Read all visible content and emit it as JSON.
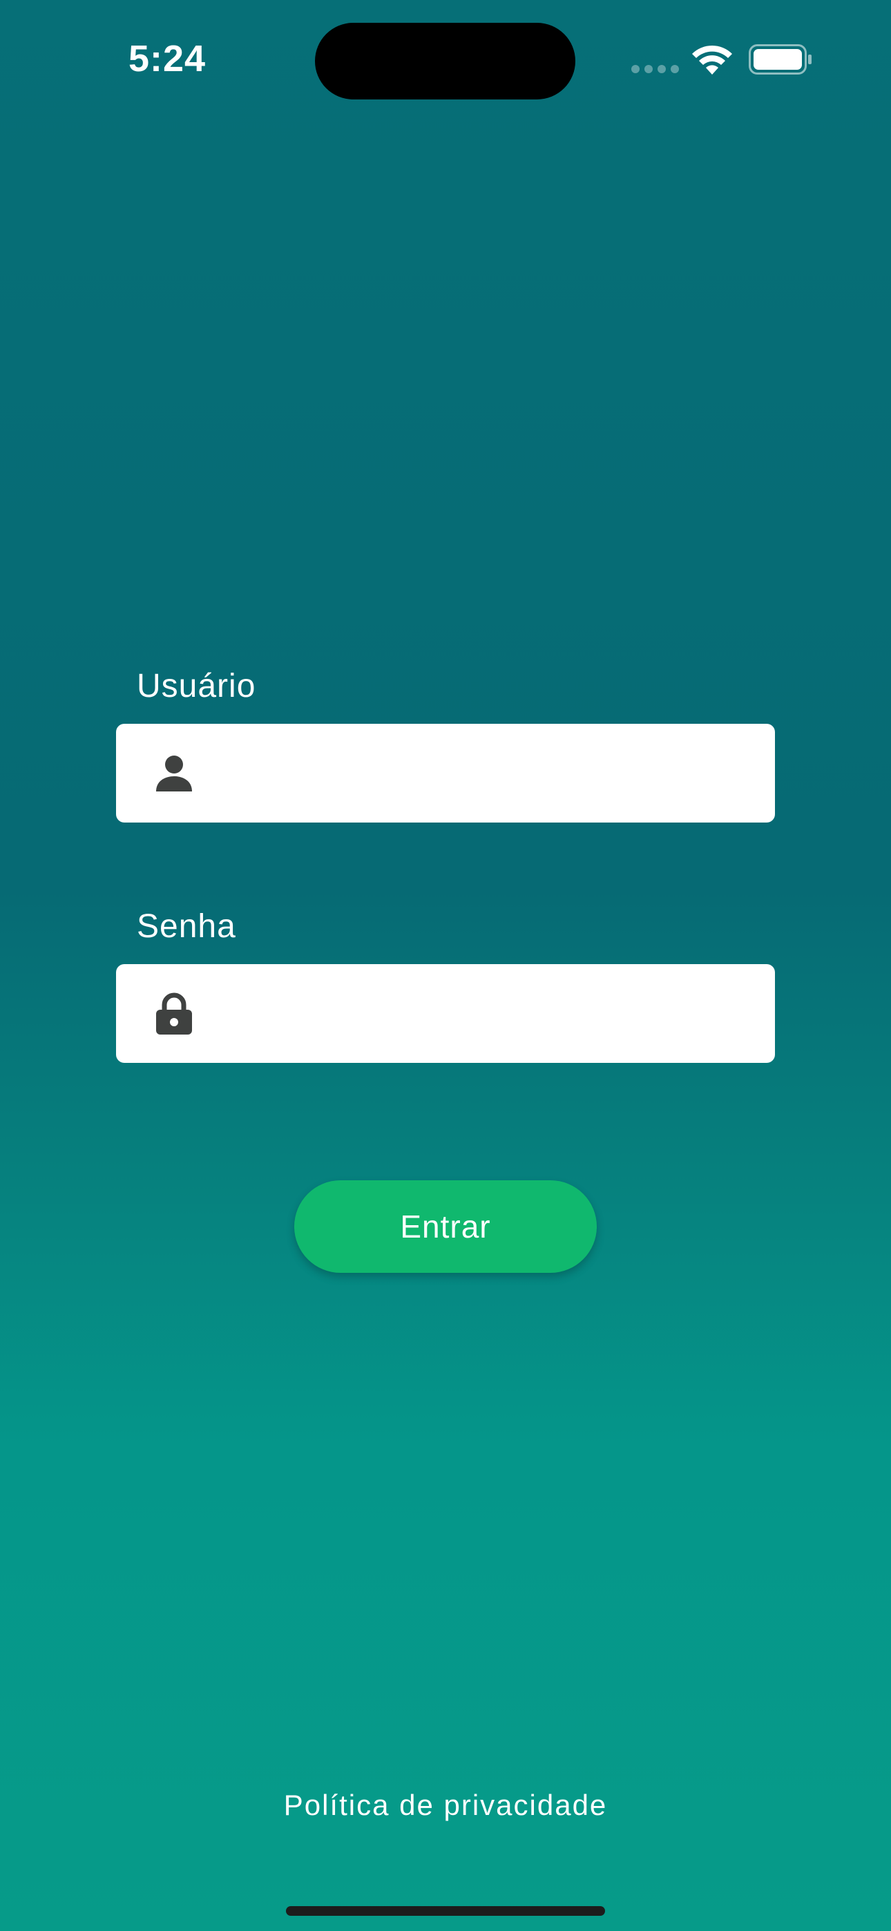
{
  "status_bar": {
    "time": "5:24",
    "icons": [
      "cellular-signal-icon",
      "wifi-icon",
      "battery-icon"
    ]
  },
  "form": {
    "username_label": "Usuário",
    "username_value": "",
    "username_icon": "person-icon",
    "password_label": "Senha",
    "password_value": "",
    "password_icon": "lock-icon",
    "submit_label": "Entrar"
  },
  "footer": {
    "privacy_link": "Política de privacidade"
  },
  "colors": {
    "background_top": "#066f77",
    "background_bottom": "#069b89",
    "button": "#10b86e",
    "icon": "#3f4140"
  }
}
